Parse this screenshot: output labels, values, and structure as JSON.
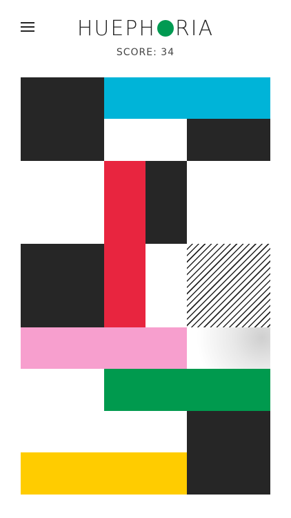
{
  "header": {
    "logo_prefix": "HUEPH",
    "logo_o": "O",
    "logo_suffix": "RIA",
    "score_label": "SCORE:",
    "score_value": "34",
    "menu_icon": "hamburger-menu-icon"
  },
  "colors": {
    "black": "#262626",
    "cyan": "#00b4d8",
    "red": "#e8253f",
    "pink": "#f79fce",
    "green": "#009a4e",
    "yellow": "#ffcc00",
    "logo_dot": "#019a52"
  },
  "board": {
    "tiles": [
      {
        "id": "t-black-1",
        "color": "black",
        "style": "solid"
      },
      {
        "id": "t-cyan",
        "color": "cyan",
        "style": "solid"
      },
      {
        "id": "t-black-2",
        "color": "black",
        "style": "solid"
      },
      {
        "id": "t-red",
        "color": "red",
        "style": "solid"
      },
      {
        "id": "t-black-3",
        "color": "black",
        "style": "solid"
      },
      {
        "id": "t-black-4",
        "color": "black",
        "style": "solid"
      },
      {
        "id": "t-stripe",
        "color": "black",
        "style": "striped"
      },
      {
        "id": "t-pink",
        "color": "pink",
        "style": "solid"
      },
      {
        "id": "t-grad",
        "color": "grey",
        "style": "gradient"
      },
      {
        "id": "t-green",
        "color": "green",
        "style": "solid"
      },
      {
        "id": "t-black-5",
        "color": "black",
        "style": "solid"
      },
      {
        "id": "t-yellow",
        "color": "yellow",
        "style": "solid"
      }
    ]
  }
}
